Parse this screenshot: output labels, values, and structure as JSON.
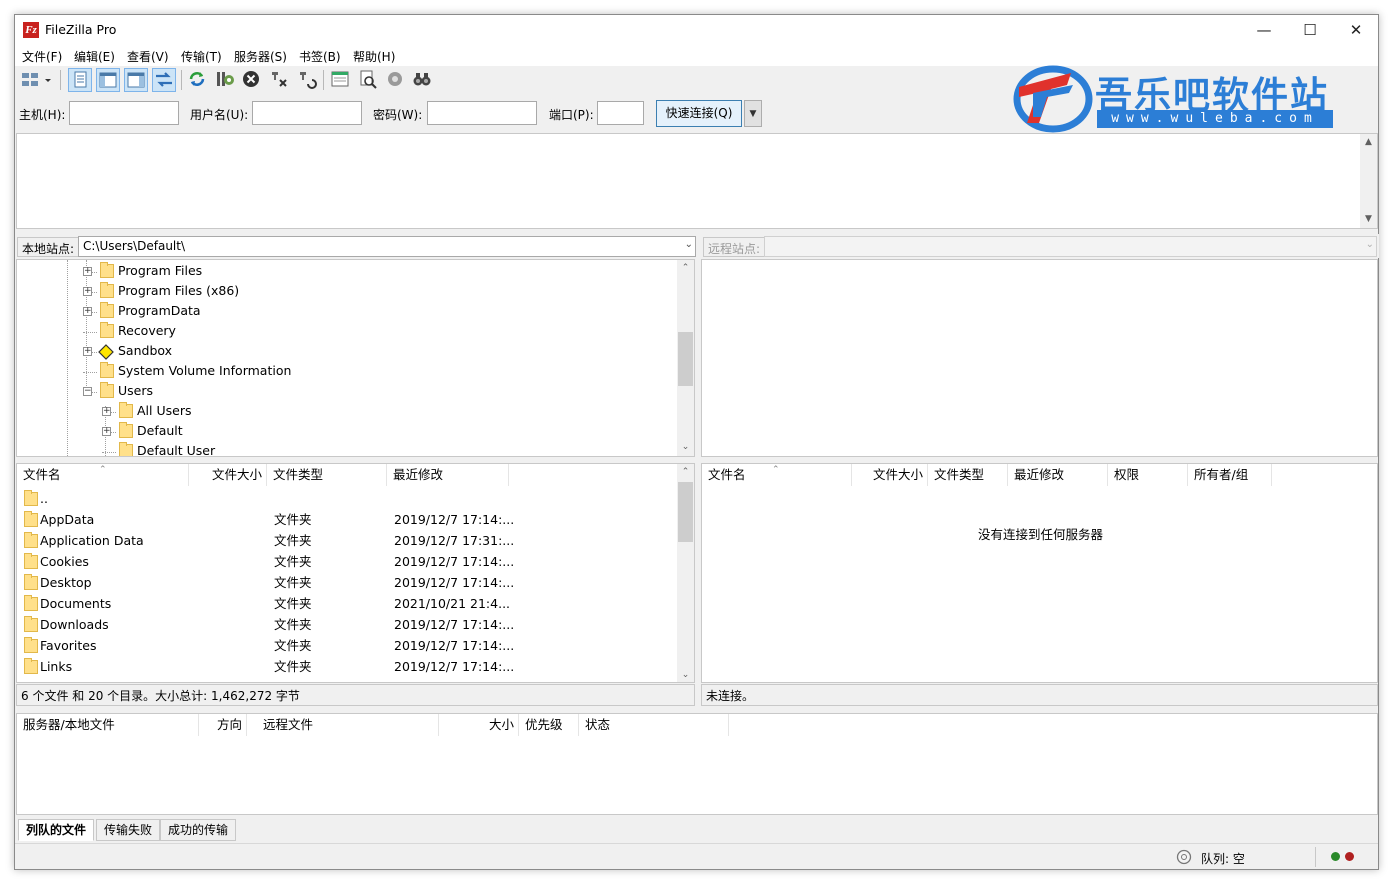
{
  "window": {
    "title": "FileZilla Pro"
  },
  "menu": [
    "文件(F)",
    "编辑(E)",
    "查看(V)",
    "传输(T)",
    "服务器(S)",
    "书签(B)",
    "帮助(H)"
  ],
  "toolbar": {
    "icons": [
      "site-manager-icon",
      "toggle-message-log-icon",
      "toggle-local-tree-icon",
      "toggle-remote-tree-icon",
      "toggle-transfer-queue-icon",
      "refresh-icon",
      "process-queue-icon",
      "cancel-icon",
      "disconnect-icon",
      "reconnect-icon",
      "directory-filter-icon",
      "search-remote-icon",
      "compare-icon",
      "find-files-icon"
    ]
  },
  "watermark": {
    "text": "吾乐吧软件站",
    "url": "www.wuleba.com"
  },
  "quickconnect": {
    "host_label": "主机(H):",
    "user_label": "用户名(U):",
    "pass_label": "密码(W):",
    "port_label": "端口(P):",
    "button": "快速连接(Q)",
    "host_value": "",
    "user_value": "",
    "pass_value": "",
    "port_value": ""
  },
  "local": {
    "site_label": "本地站点:",
    "path": "C:\\Users\\Default\\",
    "tree": [
      {
        "name": "Program Files",
        "level": 1,
        "expander": "+"
      },
      {
        "name": "Program Files (x86)",
        "level": 1,
        "expander": "+"
      },
      {
        "name": "ProgramData",
        "level": 1,
        "expander": "+"
      },
      {
        "name": "Recovery",
        "level": 1,
        "expander": ""
      },
      {
        "name": "Sandbox",
        "level": 1,
        "expander": "+",
        "special": true
      },
      {
        "name": "System Volume Information",
        "level": 1,
        "expander": ""
      },
      {
        "name": "Users",
        "level": 1,
        "expander": "-"
      },
      {
        "name": "All Users",
        "level": 2,
        "expander": "+"
      },
      {
        "name": "Default",
        "level": 2,
        "expander": "+"
      },
      {
        "name": "Default User",
        "level": 2,
        "expander": ""
      }
    ],
    "columns": [
      "文件名",
      "文件大小",
      "文件类型",
      "最近修改"
    ],
    "files": [
      {
        "name": "..",
        "size": "",
        "type": "",
        "modified": ""
      },
      {
        "name": "AppData",
        "size": "",
        "type": "文件夹",
        "modified": "2019/12/7 17:14:..."
      },
      {
        "name": "Application Data",
        "size": "",
        "type": "文件夹",
        "modified": "2019/12/7 17:31:..."
      },
      {
        "name": "Cookies",
        "size": "",
        "type": "文件夹",
        "modified": "2019/12/7 17:14:..."
      },
      {
        "name": "Desktop",
        "size": "",
        "type": "文件夹",
        "modified": "2019/12/7 17:14:..."
      },
      {
        "name": "Documents",
        "size": "",
        "type": "文件夹",
        "modified": "2021/10/21 21:4..."
      },
      {
        "name": "Downloads",
        "size": "",
        "type": "文件夹",
        "modified": "2019/12/7 17:14:..."
      },
      {
        "name": "Favorites",
        "size": "",
        "type": "文件夹",
        "modified": "2019/12/7 17:14:..."
      },
      {
        "name": "Links",
        "size": "",
        "type": "文件夹",
        "modified": "2019/12/7 17:14:..."
      }
    ],
    "status": "6 个文件 和 20 个目录。大小总计: 1,462,272 字节"
  },
  "remote": {
    "site_label": "远程站点:",
    "path": "",
    "columns": [
      "文件名",
      "文件大小",
      "文件类型",
      "最近修改",
      "权限",
      "所有者/组"
    ],
    "empty_message": "没有连接到任何服务器",
    "status": "未连接。"
  },
  "queue": {
    "columns": [
      "服务器/本地文件",
      "方向",
      "远程文件",
      "大小",
      "优先级",
      "状态"
    ],
    "tabs": [
      "列队的文件",
      "传输失败",
      "成功的传输"
    ],
    "status": "队列: 空"
  }
}
